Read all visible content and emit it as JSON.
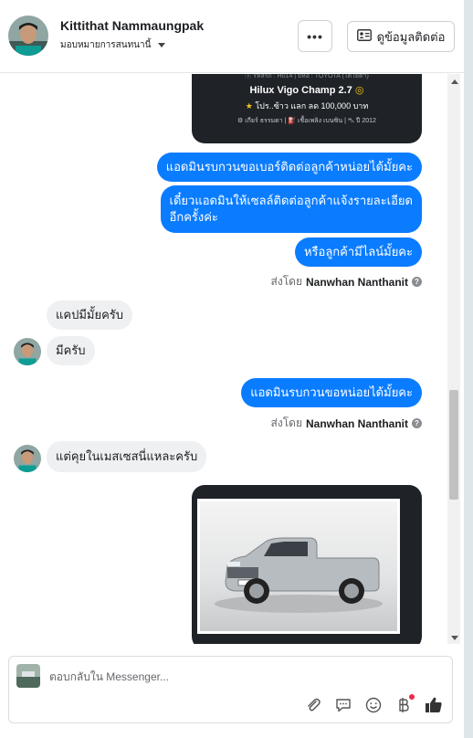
{
  "header": {
    "name": "Kittithat Nammaungpak",
    "assign_label": "มอบหมายการสนทนานี้",
    "more_label": "•••",
    "contact_label": "ดูข้อมูลติดต่อ"
  },
  "car_card_top": {
    "small_line": "ⓢ รหัสรถ : H014 | ยี่ห้อ : TOYOTA (โตโยต้า)",
    "title": "Hilux Vigo Champ 2.7",
    "price_line": "โปร..ซ้าว แลก ลด 100,000 บาท",
    "specs": "⚙ เกียร์ ธรรมดา | ⛽ เชื้อเพลิง เบนซิน | ⛍ ปี 2012"
  },
  "messages": {
    "out1": "แอดมินรบกวนขอเบอร์ติดต่อลูกค้าหน่อยได้มั้ยคะ",
    "out2_line1": "เดี๋ยวแอดมินให้เซลล์ติดต่อลูกค้าแจ้งรายละเอียด",
    "out2_line2": "อีกครั้งค่ะ",
    "out3": "หรือลูกค้ามีไลน์มั้ยคะ",
    "sent_by_prefix": "ส่งโดย",
    "sent_by_name": "Nanwhan Nanthanit",
    "in1": "แคปมีมั้ยครับ",
    "in2": "มีครับ",
    "out4": "แอดมินรบกวนขอหน่อยได้มั้ยคะ",
    "sent_by_prefix_2": "ส่งโดย",
    "sent_by_name_2": "Nanwhan Nanthanit",
    "in3": "แต่คุยในเมสเซสนี่แหละครับ"
  },
  "composer": {
    "placeholder": "ตอบกลับใน Messenger..."
  },
  "colors": {
    "accent": "#0a7cff",
    "incoming_bubble": "#eef0f2",
    "card_bg": "#1f2327"
  },
  "icons": [
    "more-icon",
    "contact-card-icon",
    "attachment-icon",
    "saved-reply-icon",
    "emoji-icon",
    "baht-icon",
    "like-icon"
  ]
}
